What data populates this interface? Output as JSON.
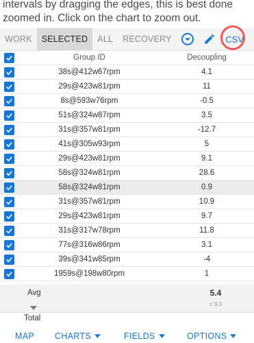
{
  "intro": {
    "text": "intervals by dragging the edges, this is best done zoomed in. Click on the chart to zoom out."
  },
  "toolbar": {
    "tabs": [
      "WORK",
      "SELECTED",
      "ALL",
      "RECOVERY"
    ],
    "active_tab": "SELECTED",
    "filter_icon": "chevron-down-circle-icon",
    "edit_icon": "pencil-icon",
    "csv_label": "CSV",
    "accent_color": "#1976d2"
  },
  "table": {
    "headers": {
      "group_id": "Group ID",
      "metric": "Decoupling"
    },
    "rows": [
      {
        "group_id": "38s@412w67rpm",
        "value": "4.1"
      },
      {
        "group_id": "29s@423w81rpm",
        "value": "11"
      },
      {
        "group_id": "8s@593w76rpm",
        "value": "-0.5"
      },
      {
        "group_id": "51s@324w87rpm",
        "value": "3.5"
      },
      {
        "group_id": "31s@357w81rpm",
        "value": "-12.7"
      },
      {
        "group_id": "41s@305w93rpm",
        "value": "5"
      },
      {
        "group_id": "29s@423w81rpm",
        "value": "9.1"
      },
      {
        "group_id": "58s@324w81rpm",
        "value": "28.6"
      },
      {
        "group_id": "58s@324w81rpm",
        "value": "0.9"
      },
      {
        "group_id": "31s@357w81rpm",
        "value": "10.9"
      },
      {
        "group_id": "29s@423w81rpm",
        "value": "9.7"
      },
      {
        "group_id": "31s@317w78rpm",
        "value": "11.8"
      },
      {
        "group_id": "77s@316w86rpm",
        "value": "3.1"
      },
      {
        "group_id": "39s@341w85rpm",
        "value": "-4"
      },
      {
        "group_id": "1959s@198w80rpm",
        "value": "1"
      }
    ],
    "avg_label": "Avg",
    "avg_value": "5.4",
    "avg_sd": "± 9.1",
    "total_label": "Total"
  },
  "bottom_nav": {
    "items": [
      "MAP",
      "CHARTS",
      "FIELDS",
      "OPTIONS"
    ]
  }
}
